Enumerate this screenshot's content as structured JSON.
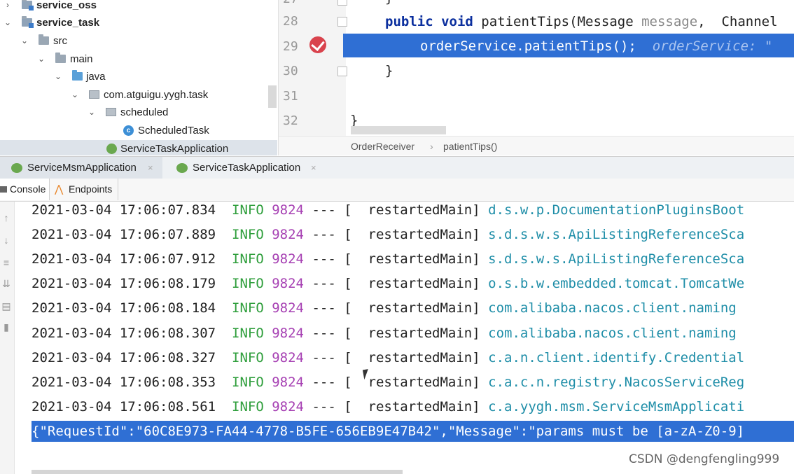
{
  "project_tree": {
    "items": [
      {
        "label": "service_oss",
        "expanded": false,
        "icon": "module-icon",
        "bold": true
      },
      {
        "label": "service_task",
        "expanded": true,
        "icon": "module-icon",
        "bold": true
      },
      {
        "label": "src",
        "expanded": true,
        "icon": "folder-icon"
      },
      {
        "label": "main",
        "expanded": true,
        "icon": "folder-icon"
      },
      {
        "label": "java",
        "expanded": true,
        "icon": "source-folder-icon"
      },
      {
        "label": "com.atguigu.yygh.task",
        "expanded": true,
        "icon": "package-icon"
      },
      {
        "label": "scheduled",
        "expanded": true,
        "icon": "package-icon"
      },
      {
        "label": "ScheduledTask",
        "icon": "class-icon",
        "class_letter": "c"
      },
      {
        "label": "ServiceTaskApplication",
        "icon": "spring-boot-icon",
        "selected": true
      }
    ]
  },
  "editor": {
    "lines": [
      {
        "num": "27",
        "text": "}"
      },
      {
        "num": "28",
        "keyword": "public void",
        "method": "patientTips",
        "signature": "(Message ",
        "param": "message",
        "rest": ",  Channel"
      },
      {
        "num": "29",
        "code": "orderService.patientTips();",
        "hint": "orderService: \""
      },
      {
        "num": "30",
        "text": "}"
      },
      {
        "num": "31",
        "text": ""
      },
      {
        "num": "32",
        "text": "}"
      }
    ],
    "breadcrumb": [
      "OrderReceiver",
      "patientTips()"
    ]
  },
  "run_tabs": [
    {
      "label": "ServiceMsmApplication",
      "active": true
    },
    {
      "label": "ServiceTaskApplication",
      "active": false
    }
  ],
  "console_tabs": [
    {
      "label": "Console",
      "active": true
    },
    {
      "label": "Endpoints",
      "active": false
    }
  ],
  "console": {
    "rows": [
      {
        "ts": "2021-03-04 17:06:07.834",
        "level": "INFO",
        "pid": "9824",
        "sep": "---",
        "thread": "[  restartedMain]",
        "logger": "d.s.w.p.DocumentationPluginsBoot"
      },
      {
        "ts": "2021-03-04 17:06:07.889",
        "level": "INFO",
        "pid": "9824",
        "sep": "---",
        "thread": "[  restartedMain]",
        "logger": "s.d.s.w.s.ApiListingReferenceSca"
      },
      {
        "ts": "2021-03-04 17:06:07.912",
        "level": "INFO",
        "pid": "9824",
        "sep": "---",
        "thread": "[  restartedMain]",
        "logger": "s.d.s.w.s.ApiListingReferenceSca"
      },
      {
        "ts": "2021-03-04 17:06:08.179",
        "level": "INFO",
        "pid": "9824",
        "sep": "---",
        "thread": "[  restartedMain]",
        "logger": "o.s.b.w.embedded.tomcat.TomcatWe"
      },
      {
        "ts": "2021-03-04 17:06:08.184",
        "level": "INFO",
        "pid": "9824",
        "sep": "---",
        "thread": "[  restartedMain]",
        "logger": "com.alibaba.nacos.client.naming"
      },
      {
        "ts": "2021-03-04 17:06:08.307",
        "level": "INFO",
        "pid": "9824",
        "sep": "---",
        "thread": "[  restartedMain]",
        "logger": "com.alibaba.nacos.client.naming"
      },
      {
        "ts": "2021-03-04 17:06:08.327",
        "level": "INFO",
        "pid": "9824",
        "sep": "---",
        "thread": "[  restartedMain]",
        "logger": "c.a.n.client.identify.Credential"
      },
      {
        "ts": "2021-03-04 17:06:08.353",
        "level": "INFO",
        "pid": "9824",
        "sep": "---",
        "thread": "[  restartedMain]",
        "logger": "c.a.c.n.registry.NacosServiceReg"
      },
      {
        "ts": "2021-03-04 17:06:08.561",
        "level": "INFO",
        "pid": "9824",
        "sep": "---",
        "thread": "[  restartedMain]",
        "logger": "c.a.yygh.msm.ServiceMsmApplicati"
      }
    ],
    "highlighted_output": "{\"RequestId\":\"60C8E973-FA44-4778-B5FE-656EB9E47B42\",\"Message\":\"params must be [a-zA-Z0-9]"
  },
  "watermark": "CSDN @dengfengling999",
  "colors": {
    "selection": "#2f6fd4",
    "info_level": "#2e9e3b",
    "pid": "#a640b3",
    "logger": "#1f8ea8",
    "keyword": "#0b2f9e"
  }
}
